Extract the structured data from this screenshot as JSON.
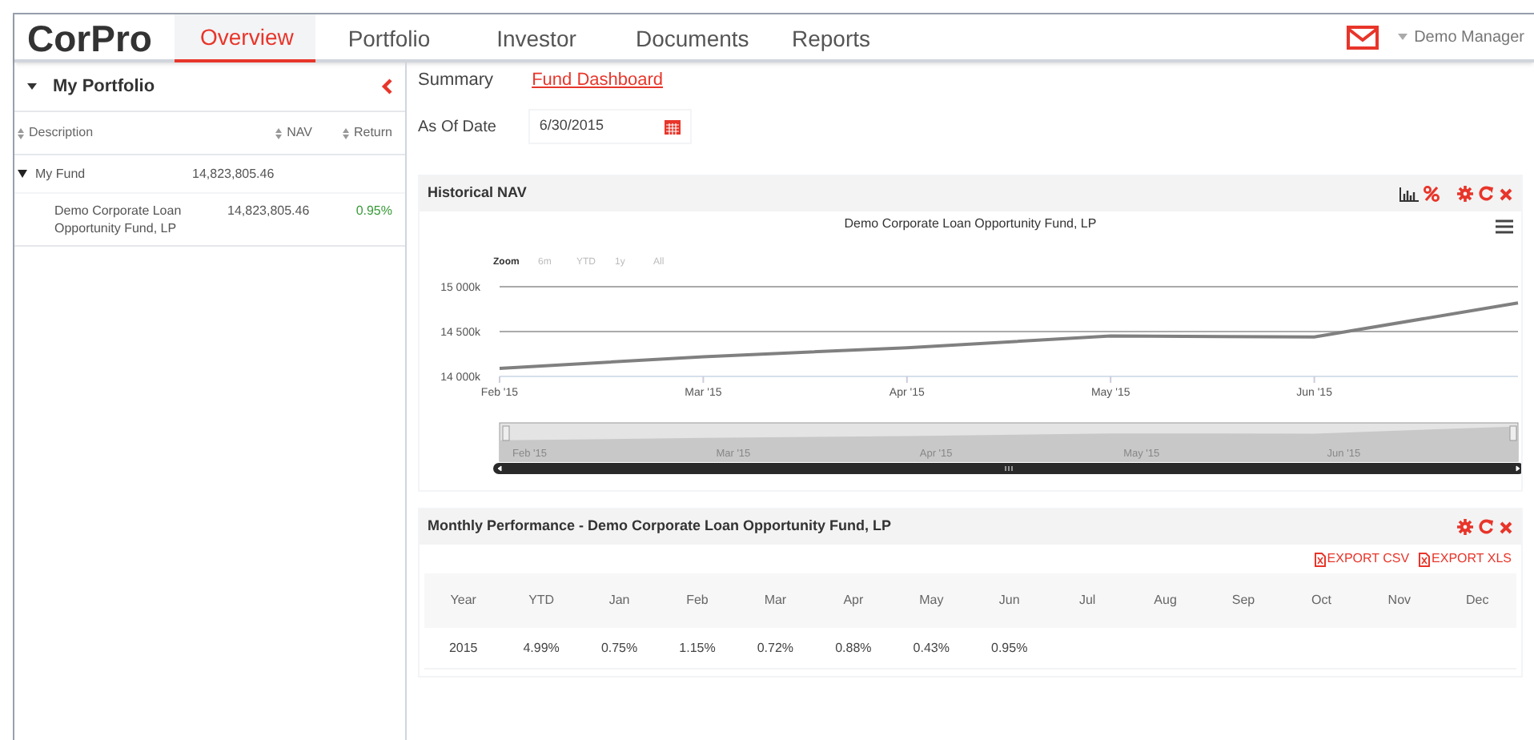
{
  "header": {
    "logo": "CorPro",
    "tabs": [
      {
        "label": "Overview",
        "selected": true
      },
      {
        "label": "Portfolio",
        "selected": false
      },
      {
        "label": "Investor",
        "selected": false
      },
      {
        "label": "Documents",
        "selected": false
      },
      {
        "label": "Reports",
        "selected": false
      }
    ],
    "user": "Demo Manager"
  },
  "sidebar": {
    "title": "My Portfolio",
    "columns": [
      "Description",
      "NAV",
      "Return"
    ],
    "rows": [
      {
        "description": "My Fund",
        "nav": "14,823,805.46",
        "return": "",
        "expanded": true,
        "children": [
          {
            "description": "Demo Corporate Loan Opportunity Fund, LP",
            "nav": "14,823,805.46",
            "return": "0.95%"
          }
        ]
      }
    ]
  },
  "subnav": [
    {
      "label": "Summary",
      "selected": false
    },
    {
      "label": "Fund Dashboard",
      "selected": true
    }
  ],
  "as_of": {
    "label": "As Of Date",
    "value": "6/30/2015"
  },
  "historical_nav": {
    "title": "Historical NAV",
    "range_buttons": [
      {
        "label": "Zoom",
        "kind": "label"
      },
      {
        "label": "6m",
        "selected": false,
        "kind": "button"
      },
      {
        "label": "YTD",
        "selected": false,
        "kind": "button"
      },
      {
        "label": "1y",
        "selected": false,
        "kind": "button"
      },
      {
        "label": "All",
        "selected": false,
        "kind": "button"
      }
    ],
    "navigator_labels": [
      "Feb '15",
      "Mar '15",
      "Apr '15",
      "May '15",
      "Jun '15"
    ],
    "chart_data": {
      "type": "line",
      "title": "Demo Corporate Loan Opportunity Fund, LP",
      "categories": [
        "Feb '15",
        "Mar '15",
        "Apr '15",
        "May '15",
        "Jun '15",
        null
      ],
      "series": [
        {
          "color": "#808080",
          "values": [
            14090,
            14220,
            14320,
            14450,
            14440,
            14820
          ]
        }
      ],
      "ylim": [
        14000,
        15000
      ],
      "yticks": [
        {
          "value": 14000,
          "label": "14 000k"
        },
        {
          "value": 14500,
          "label": "14 500k"
        },
        {
          "value": 15000,
          "label": "15 000k"
        }
      ]
    }
  },
  "monthly": {
    "title": "Monthly Performance - Demo Corporate Loan Opportunity Fund, LP",
    "exports": [
      "EXPORT CSV",
      "EXPORT XLS"
    ],
    "columns": [
      "Year",
      "YTD",
      "Jan",
      "Feb",
      "Mar",
      "Apr",
      "May",
      "Jun",
      "Jul",
      "Aug",
      "Sep",
      "Oct",
      "Nov",
      "Dec"
    ],
    "rows": [
      [
        "2015",
        "4.99%",
        "0.75%",
        "1.15%",
        "0.72%",
        "0.88%",
        "0.43%",
        "0.95%",
        "",
        "",
        "",
        "",
        "",
        ""
      ]
    ]
  }
}
